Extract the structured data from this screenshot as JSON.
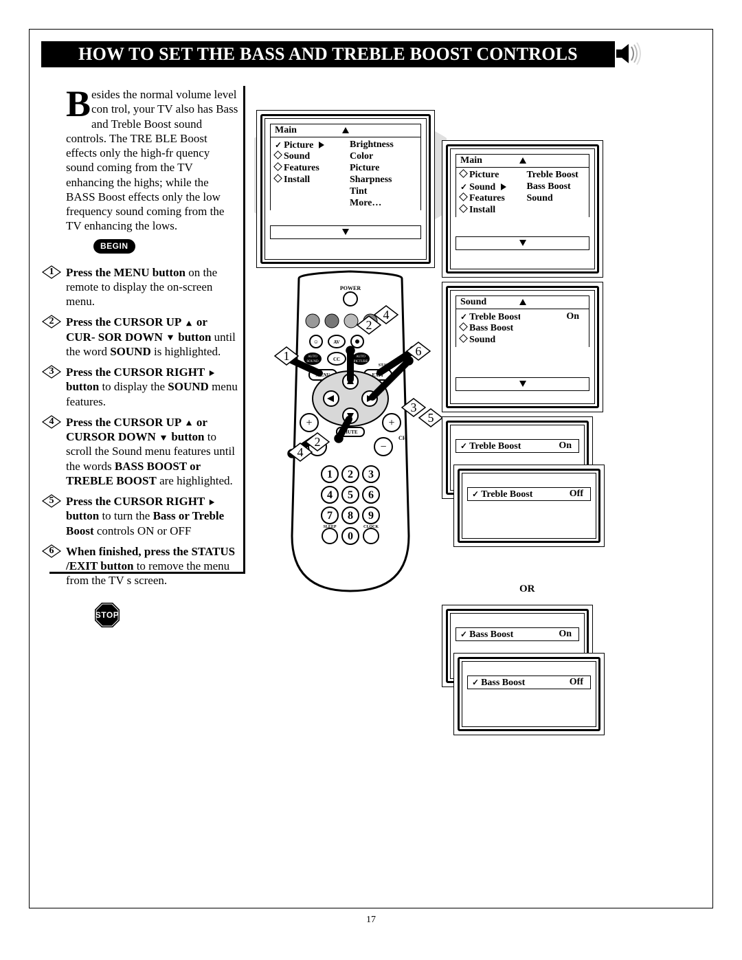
{
  "page_number": "17",
  "title": "HOW TO SET THE BASS AND TREBLE BOOST CONTROLS",
  "intro_text": "esides the normal volume level con trol, your TV also has Bass and Treble Boost sound controls. The TRE BLE Boost effects only the high-fr quency sound coming from the TV enhancing the highs; while the BASS Boost effects only the low frequency sound coming from the TV enhancing the lows.",
  "begin_label": "BEGIN",
  "stop_label": "STOP",
  "steps": {
    "1": {
      "b": "Press the MENU button",
      "rest": " on the remote to display the on-screen menu."
    },
    "2": {
      "b1": "Press the CURSOR UP ",
      "b2": " or CUR-\nSOR DOWN ",
      "b3": " button",
      "rest1": " until the word ",
      "b4": "SOUND",
      "rest2": " is highlighted."
    },
    "3": {
      "b1": "Press the CURSOR RIGHT ",
      "b2": " button",
      "rest1": " to display the ",
      "b3": "SOUND",
      "rest2": " menu features."
    },
    "4": {
      "b1": "Press the CURSOR UP ",
      "b2": " or CURSOR DOWN ",
      "b3": " button ",
      "rest1": "to scroll the Sound menu features until the words ",
      "b4": "BASS BOOST or TREBLE BOOST",
      "rest2": " are highlighted."
    },
    "5": {
      "b1": "Press the CURSOR RIGHT ",
      "b2": " button",
      "rest1": " to turn the ",
      "b3": "Bass or Treble Boost",
      "rest2": " controls ON or OFF"
    },
    "6": {
      "b1": "When finished, press the STATUS /EXIT button",
      "rest": " to remove the menu from the TV s screen."
    }
  },
  "osd1": {
    "header": "Main",
    "left": [
      "Picture",
      "Sound",
      "Features",
      "Install"
    ],
    "right": [
      "Brightness",
      "Color",
      "Picture",
      "Sharpness",
      "Tint",
      "More…"
    ],
    "selected": 0
  },
  "osd2": {
    "header": "Main",
    "left": [
      "Picture",
      "Sound",
      "Features",
      "Install"
    ],
    "right": [
      "Treble Boost",
      "Bass Boost",
      "Sound"
    ],
    "selected": 1
  },
  "osd3": {
    "header": "Sound",
    "left": [
      "Treble Boost",
      "Bass Boost",
      "Sound"
    ],
    "right": [
      "On"
    ],
    "selected": 0
  },
  "osd4": {
    "label": "Treble Boost",
    "value": "On"
  },
  "osd5": {
    "label": "Treble Boost",
    "value": "Off"
  },
  "or_label": "OR",
  "osd6": {
    "label": "Bass Boost",
    "value": "On"
  },
  "osd7": {
    "label": "Bass Boost",
    "value": "Off"
  }
}
